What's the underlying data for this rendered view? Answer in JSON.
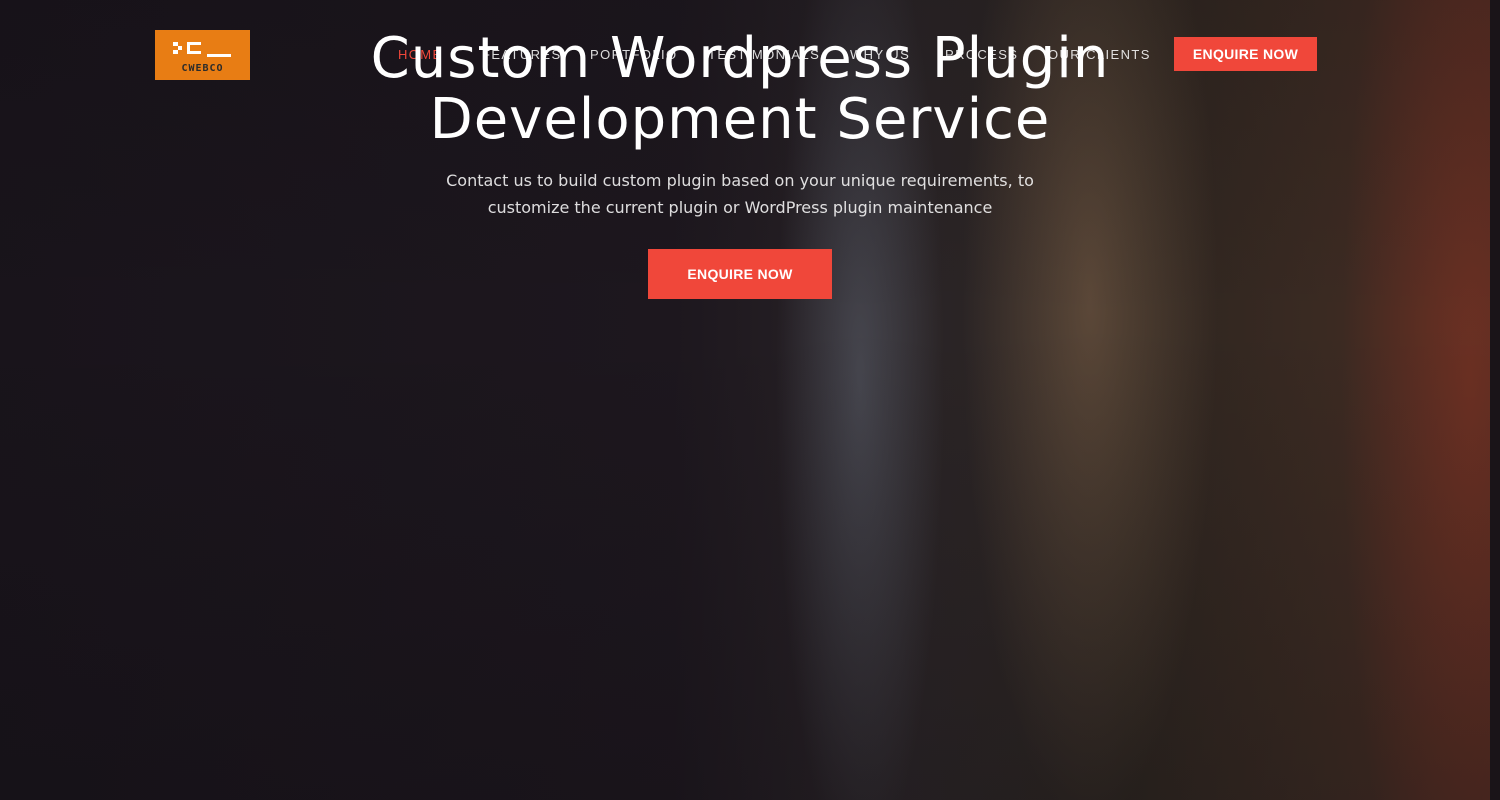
{
  "brand": {
    "logo_text": "CWEBCO",
    "logo_color": "#e87d14"
  },
  "nav": {
    "items": [
      {
        "label": "HOME",
        "active": true
      },
      {
        "label": "FEATURES",
        "active": false
      },
      {
        "label": "PORTFOLIO",
        "active": false
      },
      {
        "label": "TESTIMONIALS",
        "active": false
      },
      {
        "label": "WHY US",
        "active": false
      },
      {
        "label": "PROCESS",
        "active": false
      },
      {
        "label": "OUR CLIENTS",
        "active": false
      }
    ],
    "active_color": "#f0473a"
  },
  "header": {
    "cta_label": "ENQUIRE NOW"
  },
  "hero": {
    "title_line1": "Custom Wordpress Plugin",
    "title_line2": "Development Service",
    "subtitle_line1": "Contact us to build custom plugin based on your unique requirements, to",
    "subtitle_line2": "customize the current plugin or WordPress plugin maintenance",
    "cta_label": "ENQUIRE NOW"
  },
  "colors": {
    "accent": "#f0473a",
    "background": "#1b161c"
  }
}
